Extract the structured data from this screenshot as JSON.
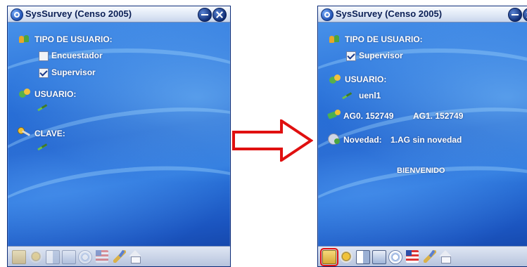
{
  "caption": "",
  "left_screen": {
    "window_title": "SysSurvey (Censo 2005)",
    "user_type_label": "TIPO DE USUARIO:",
    "options": [
      {
        "label": "Encuestador",
        "checked": false
      },
      {
        "label": "Supervisor",
        "checked": true
      }
    ],
    "user_label": "USUARIO:",
    "password_label": "CLAVE:"
  },
  "right_screen": {
    "window_title": "SysSurvey (Censo 2005)",
    "user_type_label": "TIPO DE USUARIO:",
    "user_type_value": "Supervisor",
    "user_type_checked": true,
    "user_label": "USUARIO:",
    "user_value": "uenl1",
    "ag0": "AG0. 152749",
    "ag1": "AG1. 152749",
    "novedad_label": "Novedad:",
    "novedad_value": "1.AG sin novedad",
    "welcome_text": "BIENVENIDO"
  },
  "toolbar_icons": [
    "folder-icon",
    "settings-icon",
    "documents-icon",
    "sheets-icon",
    "sync-icon",
    "flag-icon",
    "brush-icon",
    "home-icon"
  ],
  "highlight_color": "#e01010",
  "arrow_color": "#e01010"
}
